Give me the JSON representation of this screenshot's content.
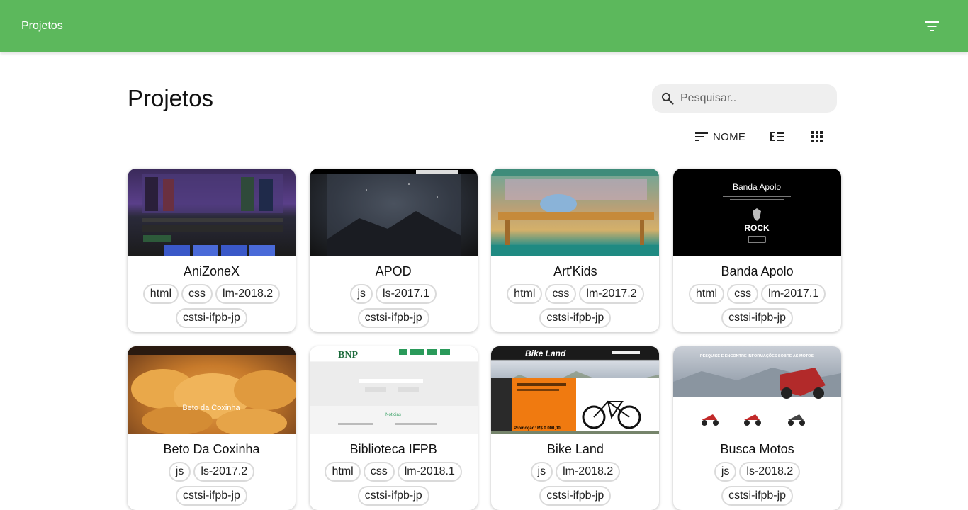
{
  "appbar": {
    "title": "Projetos",
    "filter_icon": "filter-list-icon"
  },
  "page": {
    "title": "Projetos"
  },
  "search": {
    "placeholder": "Pesquisar..",
    "value": "",
    "icon": "search-icon"
  },
  "toolbar": {
    "sort_label": "NOME",
    "sort_icon": "sort-icon",
    "list_view_icon": "checklist-icon",
    "grid_view_icon": "grid-icon"
  },
  "projects": [
    {
      "name": "AniZoneX",
      "tags": [
        "html",
        "css",
        "lm-2018.2",
        "cstsi-ifpb-jp"
      ],
      "thumb": "anime"
    },
    {
      "name": "APOD",
      "tags": [
        "js",
        "ls-2017.1",
        "cstsi-ifpb-jp"
      ],
      "thumb": "apod"
    },
    {
      "name": "Art'Kids",
      "tags": [
        "html",
        "css",
        "lm-2017.2",
        "cstsi-ifpb-jp"
      ],
      "thumb": "kids"
    },
    {
      "name": "Banda Apolo",
      "tags": [
        "html",
        "css",
        "lm-2017.1",
        "cstsi-ifpb-jp"
      ],
      "thumb": "banda"
    },
    {
      "name": "Beto Da Coxinha",
      "tags": [
        "js",
        "ls-2017.2",
        "cstsi-ifpb-jp"
      ],
      "thumb": "beto"
    },
    {
      "name": "Biblioteca IFPB",
      "tags": [
        "html",
        "css",
        "lm-2018.1",
        "cstsi-ifpb-jp"
      ],
      "thumb": "bib"
    },
    {
      "name": "Bike Land",
      "tags": [
        "js",
        "lm-2018.2",
        "cstsi-ifpb-jp"
      ],
      "thumb": "bike"
    },
    {
      "name": "Busca Motos",
      "tags": [
        "js",
        "ls-2018.2",
        "cstsi-ifpb-jp"
      ],
      "thumb": "motos"
    }
  ],
  "thumb_text": {
    "banda": {
      "heading": "Banda Apolo",
      "rock": "ROCK"
    },
    "beto": {
      "caption": "Beto da Coxinha"
    },
    "bib": {
      "logo": "BNP",
      "heading": "Notícias"
    },
    "bike": {
      "logo": "Bike Land",
      "promo": "Promoção: R$ 0.000,00"
    },
    "motos": {
      "banner": "PESQUISE E ENCONTRE INFORMAÇÕES SOBRE AS MOTOS"
    }
  },
  "colors": {
    "appbar": "#5cb85c",
    "search_bg": "#efefef",
    "tag_border": "#dadada"
  }
}
